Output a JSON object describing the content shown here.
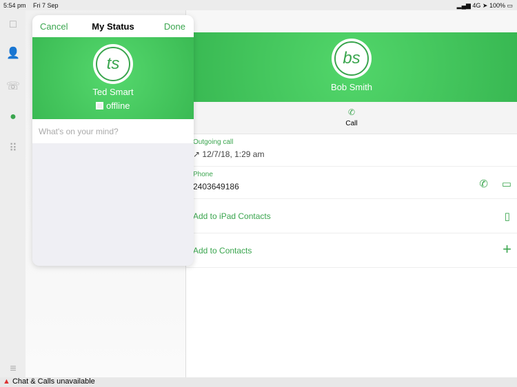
{
  "status_bar": {
    "time": "5:54 pm",
    "date": "Fri 7 Sep",
    "network": "4G",
    "battery": "100%"
  },
  "popover": {
    "cancel": "Cancel",
    "title": "My Status",
    "done": "Done",
    "initials": "ts",
    "name": "Ted Smart",
    "presence": "offline",
    "placeholder": "What's on your mind?"
  },
  "contact": {
    "initials": "bs",
    "name": "Bob Smith",
    "call_label": "Call",
    "recent_label": "Outgoing call",
    "recent_value": "12/7/18, 1:29 am",
    "phone_label": "Phone",
    "phone_value": "2403649186",
    "add_ipad": "Add to iPad Contacts",
    "add_contacts": "Add to Contacts"
  },
  "footer": {
    "warning": "Chat & Calls unavailable"
  },
  "colors": {
    "accent": "#3aa54e"
  }
}
